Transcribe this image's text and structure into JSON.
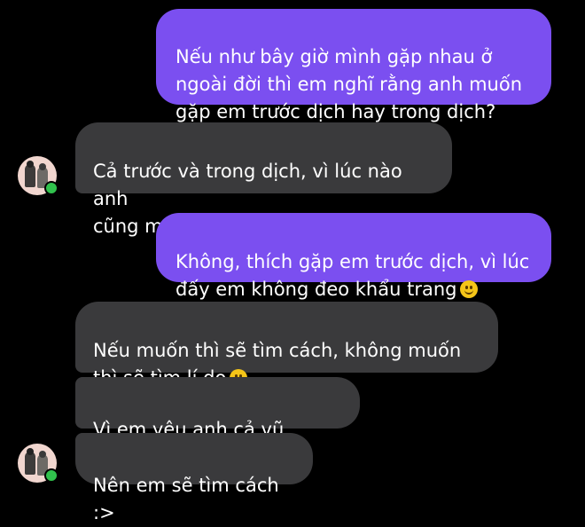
{
  "colors": {
    "background": "#000000",
    "sent_bubble": "#7b4ff0",
    "received_bubble": "#3a3a3c",
    "online_indicator": "#31c24d"
  },
  "messages": [
    {
      "direction": "sent",
      "text": "Nếu như bây giờ mình gặp nhau ở\nngoài đời thì em nghĩ rằng anh muốn\ngặp em trước dịch hay trong dịch?",
      "emoji": ""
    },
    {
      "direction": "received",
      "text": "Cả trước và trong dịch, vì lúc nào anh\ncũng muốn gặp em",
      "emoji": "slightly-smiling-face"
    },
    {
      "direction": "sent",
      "text": "Không, thích gặp em trước dịch, vì lúc\nđấy em không đeo khẩu trang",
      "emoji": "slightly-smiling-face"
    },
    {
      "direction": "received",
      "text": "Nếu muốn thì sẽ tìm cách, không muốn\nthì sẽ tìm lí do",
      "emoji": "slightly-smiling-face"
    },
    {
      "direction": "received",
      "text": "Vì em yêu anh cả vũ trụuuu",
      "emoji": ""
    },
    {
      "direction": "received",
      "text": "Nên em sẽ tìm cách :>",
      "emoji": ""
    }
  ],
  "icons": {
    "avatar": "contact-avatar",
    "online": "online-status-dot",
    "emoji": "slightly-smiling-face"
  }
}
